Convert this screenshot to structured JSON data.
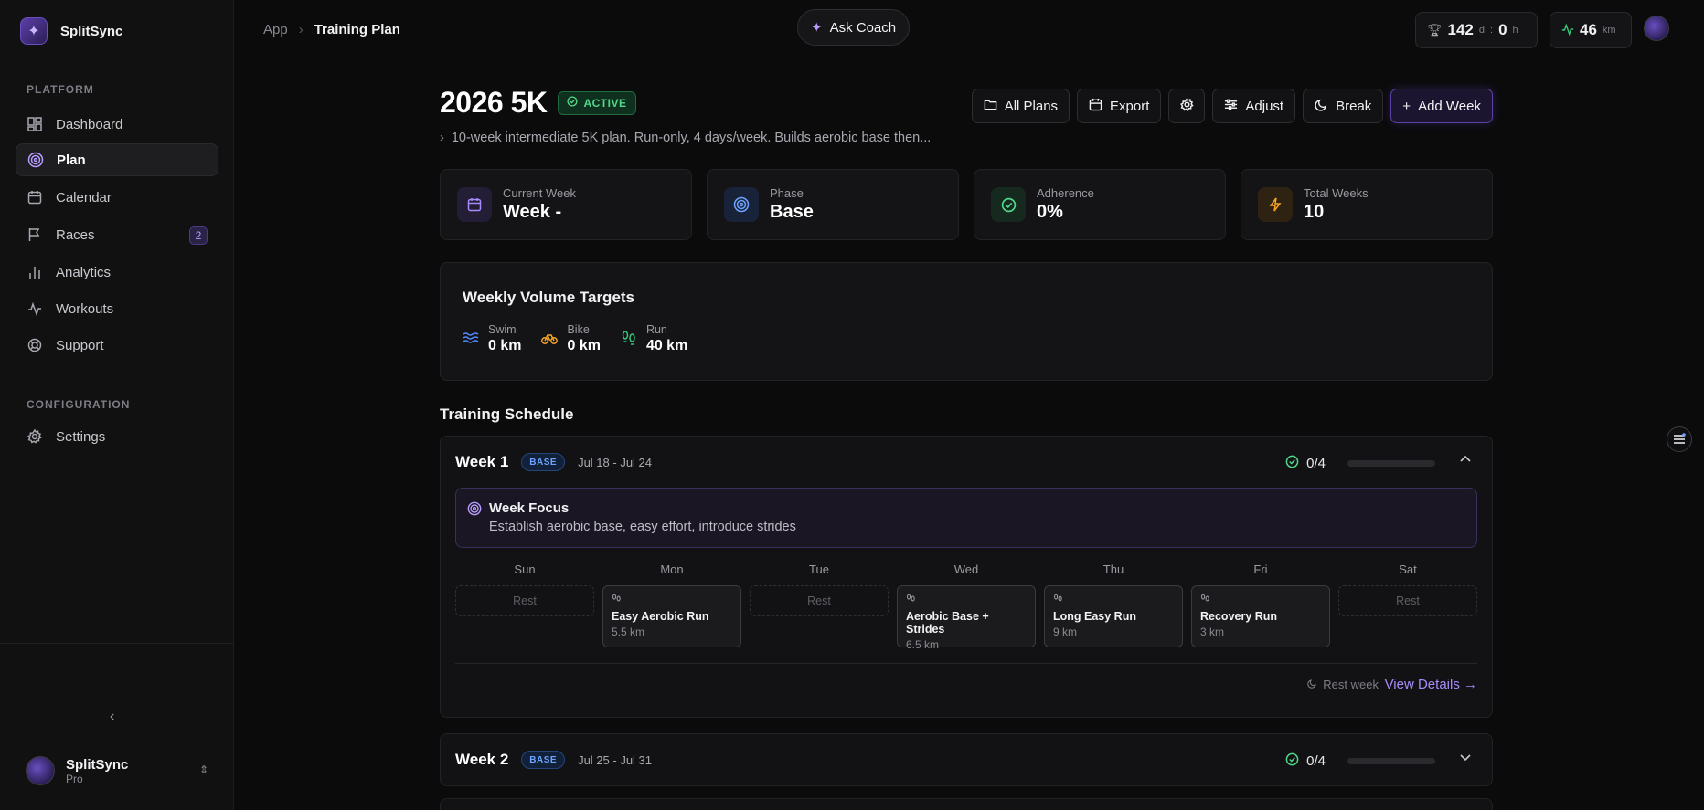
{
  "brand": {
    "name": "SplitSync"
  },
  "sidebar": {
    "platform_label": "PLATFORM",
    "items": [
      {
        "label": "Dashboard",
        "icon": "dashboard-icon"
      },
      {
        "label": "Plan",
        "icon": "target-icon",
        "active": true
      },
      {
        "label": "Calendar",
        "icon": "calendar-icon"
      },
      {
        "label": "Races",
        "icon": "flag-icon",
        "badge": "2"
      },
      {
        "label": "Analytics",
        "icon": "bar-chart-icon"
      },
      {
        "label": "Workouts",
        "icon": "activity-icon"
      },
      {
        "label": "Support",
        "icon": "lifebuoy-icon"
      }
    ],
    "config_label": "CONFIGURATION",
    "settings_label": "Settings",
    "user": {
      "name": "SplitSync",
      "plan": "Pro"
    }
  },
  "topbar": {
    "breadcrumb": [
      "App",
      "Training Plan"
    ],
    "ask_coach": "Ask Coach",
    "time_stat": {
      "days": "142",
      "days_unit": "d",
      "sep": ":",
      "hours": "0",
      "hours_unit": "h"
    },
    "distance_stat": {
      "value": "46",
      "unit": "km"
    }
  },
  "plan": {
    "title": "2026 5K",
    "status": "ACTIVE",
    "description": "10-week intermediate 5K plan. Run-only, 4 days/week. Builds aerobic base then...",
    "actions": {
      "all_plans": "All Plans",
      "export": "Export",
      "adjust": "Adjust",
      "break": "Break",
      "add_week": "Add Week"
    },
    "stats": [
      {
        "label": "Current Week",
        "value": "Week -",
        "color": "#a78bfa"
      },
      {
        "label": "Phase",
        "value": "Base",
        "color": "#6ea4ff"
      },
      {
        "label": "Adherence",
        "value": "0%",
        "color": "#52d68a"
      },
      {
        "label": "Total Weeks",
        "value": "10",
        "color": "#f5a524"
      }
    ],
    "volume": {
      "title": "Weekly Volume Targets",
      "items": [
        {
          "label": "Swim",
          "value": "0 km",
          "color": "#4f8cff"
        },
        {
          "label": "Bike",
          "value": "0 km",
          "color": "#f5a524"
        },
        {
          "label": "Run",
          "value": "40 km",
          "color": "#34c77b"
        }
      ]
    },
    "schedule_title": "Training Schedule",
    "weeks": [
      {
        "title": "Week 1",
        "phase": "BASE",
        "dates": "Jul 18 - Jul 24",
        "progress": "0/4",
        "progress_fraction": 0,
        "focus_title": "Week Focus",
        "focus_text": "Establish aerobic base, easy effort, introduce strides",
        "days": [
          {
            "day": "Sun",
            "rest": "Rest"
          },
          {
            "day": "Mon",
            "workout": "Easy Aerobic Run",
            "distance": "5.5 km"
          },
          {
            "day": "Tue",
            "rest": "Rest"
          },
          {
            "day": "Wed",
            "workout": "Aerobic Base + Strides",
            "distance": "6.5 km"
          },
          {
            "day": "Thu",
            "workout": "Long Easy Run",
            "distance": "9 km"
          },
          {
            "day": "Fri",
            "workout": "Recovery Run",
            "distance": "3 km"
          },
          {
            "day": "Sat",
            "rest": "Rest"
          }
        ],
        "rest_week": "Rest week",
        "view_details": "View Details →"
      },
      {
        "title": "Week 2",
        "phase": "BASE",
        "dates": "Jul 25 - Jul 31",
        "progress": "0/4",
        "progress_fraction": 0
      }
    ]
  }
}
